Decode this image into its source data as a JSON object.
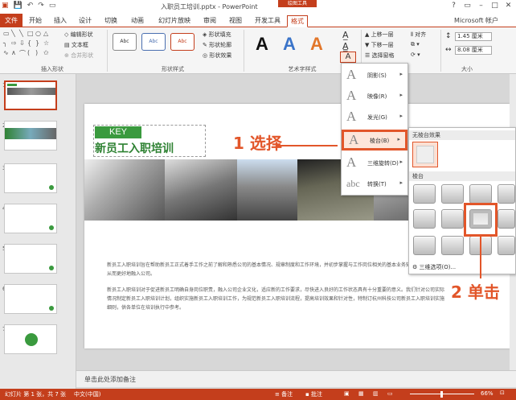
{
  "window": {
    "title": "入职员工培训.pptx - PowerPoint",
    "context_group": "绘图工具"
  },
  "tabs": [
    {
      "label": "文件"
    },
    {
      "label": "开始"
    },
    {
      "label": "插入"
    },
    {
      "label": "设计"
    },
    {
      "label": "切换"
    },
    {
      "label": "动画"
    },
    {
      "label": "幻灯片放映"
    },
    {
      "label": "审阅"
    },
    {
      "label": "视图"
    },
    {
      "label": "开发工具"
    },
    {
      "label": "格式"
    }
  ],
  "account": "Microsoft 帐户",
  "ribbon": {
    "insert_shapes": {
      "label": "插入形状",
      "edit_shape": "编辑形状",
      "text_box": "文本框",
      "merge_shapes": "合并形状"
    },
    "shape_styles": {
      "label": "形状样式",
      "preset": "Abc",
      "fill": "形状填充",
      "outline": "形状轮廓",
      "effects": "形状效果"
    },
    "wordart": {
      "label": "艺术字样式",
      "letter": "A"
    },
    "arrange": {
      "bring_forward": "上移一层",
      "send_backward": "下移一层",
      "selection_pane": "选择窗格",
      "align": "对齐"
    },
    "size": {
      "label": "大小",
      "height": "1.45 厘米",
      "width": "8.08 厘米"
    }
  },
  "thumbnails": [
    {
      "num": "1"
    },
    {
      "num": "2"
    },
    {
      "num": "3"
    },
    {
      "num": "4"
    },
    {
      "num": "5"
    },
    {
      "num": "6"
    },
    {
      "num": "7"
    }
  ],
  "slide": {
    "badge": "KEY",
    "title": "新员工入职培训",
    "paragraphs": [
      "新员工入职培训旨在帮助新员工正式着手工作之前了解和熟悉公司的基本情况、规章制度和工作环境，并初步掌握与工作岗位相关的基本业务知识和工作技能，从而更好地融入公司。",
      "新员工入职培训对于促进新员工明确自身岗位职责，融入公司企业文化，适应新的工作要求，尽快进入良好的工作状态具有十分重要的意义。我们针对公司实际情况制定新员工入职培训计划，组织实施新员工入职培训工作，为规范新员工入职培训流程，提高培训效果和针对性，特制订杭州科技公司新员工入职培训实施细则，供各单位在培训执行中参考。"
    ]
  },
  "notes": "单击此处添加备注",
  "status": {
    "slide_info": "幻灯片 第 1 张，共 7 张",
    "language": "中文(中国)",
    "notes_btn": "备注",
    "comments_btn": "批注",
    "zoom": "66%"
  },
  "effects_menu": {
    "items": [
      {
        "label": "阴影(S)"
      },
      {
        "label": "映像(R)"
      },
      {
        "label": "发光(G)"
      },
      {
        "label": "棱台(B)"
      },
      {
        "label": "三维旋转(D)"
      },
      {
        "label": "转换(T)"
      }
    ]
  },
  "bevel_panel": {
    "no_bevel_header": "无棱台效果",
    "bevel_header": "棱台",
    "options_link": "三维选项(O)..."
  },
  "annotations": {
    "step1": "1 选择",
    "step2": "2 单击"
  },
  "colors": {
    "accent": "#C43E1C",
    "green": "#3A9A3E",
    "highlight": "#E2562A"
  }
}
